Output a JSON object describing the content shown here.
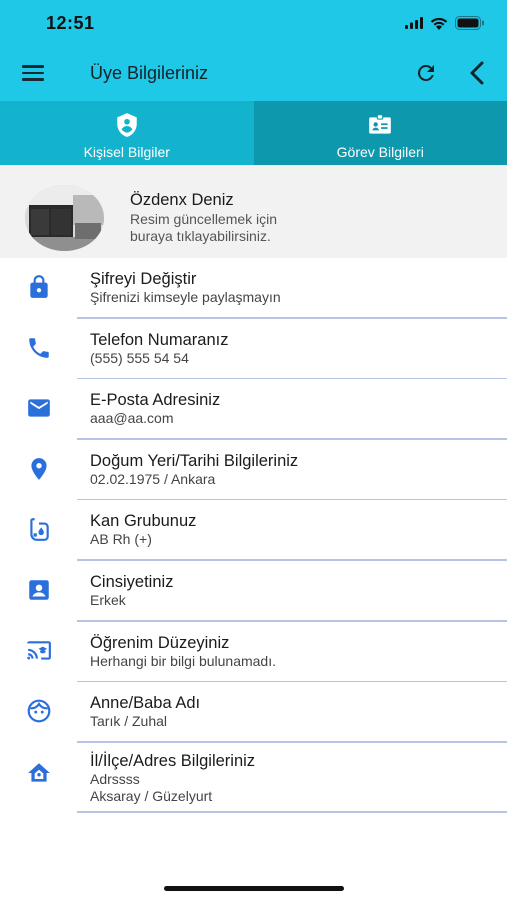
{
  "status_bar": {
    "time": "12:51"
  },
  "app_bar": {
    "title": "Üye Bilgileriniz"
  },
  "tabs": [
    {
      "label": "Kişisel Bilgiler",
      "icon": "shield-person-icon",
      "active": true
    },
    {
      "label": "Görev Bilgileri",
      "icon": "badge-card-icon",
      "active": false
    }
  ],
  "profile": {
    "name": "Özdenx Deniz",
    "hint_line1": "Resim güncellemek için",
    "hint_line2": "buraya tıklayabilirsiniz."
  },
  "items": [
    {
      "icon": "lock-icon",
      "title": "Şifreyi Değiştir",
      "sub": [
        "Şifrenizi kimseyle paylaşmayın"
      ]
    },
    {
      "icon": "phone-icon",
      "title": "Telefon Numaranız",
      "sub": [
        "(555) 555 54 54"
      ]
    },
    {
      "icon": "mail-icon",
      "title": "E-Posta Adresiniz",
      "sub": [
        "aaa@aa.com"
      ]
    },
    {
      "icon": "location-pin-icon",
      "title": "Doğum Yeri/Tarihi Bilgileriniz",
      "sub": [
        "02.02.1975 / Ankara"
      ]
    },
    {
      "icon": "blood-bag-icon",
      "title": "Kan Grubunuz",
      "sub": [
        "AB Rh (+)"
      ]
    },
    {
      "icon": "contact-card-icon",
      "title": "Cinsiyetiniz",
      "sub": [
        "Erkek"
      ]
    },
    {
      "icon": "education-screen-icon",
      "title": "Öğrenim Düzeyiniz",
      "sub": [
        "Herhangi bir bilgi bulunamadı."
      ]
    },
    {
      "icon": "face-icon",
      "title": "Anne/Baba Adı",
      "sub": [
        "Tarık / Zuhal"
      ]
    },
    {
      "icon": "home-icon",
      "title": "İl/İlçe/Adres Bilgileriniz",
      "sub": [
        "Adrssss",
        "Aksaray / Güzelyurt"
      ]
    }
  ],
  "colors": {
    "primary": "#1fc8e6",
    "tab_active": "#14b3cd",
    "tab_inactive": "#0e98ad",
    "icon_blue": "#2a6fdb",
    "divider": "#b7c4e4"
  }
}
